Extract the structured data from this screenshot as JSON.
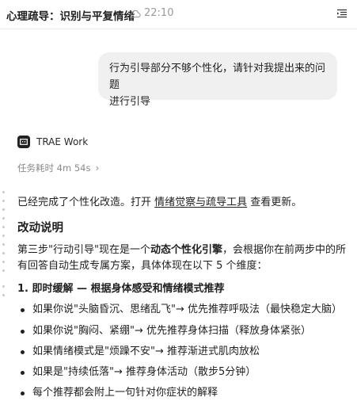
{
  "header": {
    "title": "心理疏导：识别与平复情绪",
    "sync_time": "22:10",
    "menu_icon": "sidebar-toggle-icon"
  },
  "user_message": {
    "line1": "行为引导部分不够个性化，请针对我提出来的问题",
    "line2": "进行引导"
  },
  "agent": {
    "name": "TRAE Work",
    "duration_label": "任务耗时 4m 54s"
  },
  "response": {
    "intro_prefix": "已经完成了个性化改造。打开 ",
    "intro_link": "情绪觉察与疏导工具",
    "intro_suffix": " 查看更新。",
    "heading": "改动说明",
    "para_prefix": "第三步\"行动引导\"现在是一个",
    "para_bold": "动态个性化引擎",
    "para_suffix": "，会根据你在前两步中的所有回答自动生成专属方案，具体体现在以下 5 个维度：",
    "section1_title": "1. 即时缓解 — 根据身体感受和情绪模式推荐",
    "bullets": [
      "如果你说\"头脑昏沉、思绪乱飞\"→ 优先推荐呼吸法（最快稳定大脑）",
      "如果你说\"胸闷、紧绷\"→ 优先推荐身体扫描（释放身体紧张）",
      "如果情绪模式是\"烦躁不安\"→ 推荐渐进式肌肉放松",
      "如果是\"持续低落\"→ 推荐身体活动（散步5分钟）",
      "每个推荐都会附上一句针对你症状的解释"
    ]
  }
}
